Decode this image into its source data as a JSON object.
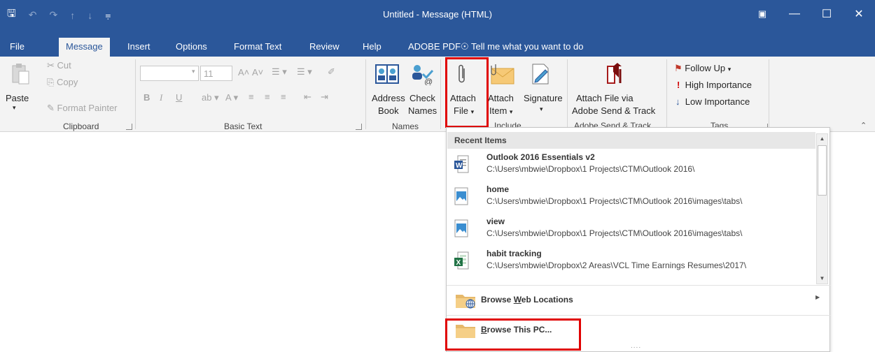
{
  "window": {
    "title": "Untitled  -  Message (HTML)",
    "qat": [
      "save-icon",
      "undo-icon",
      "redo-icon",
      "up-icon",
      "down-icon",
      "customize-icon"
    ]
  },
  "tabs": [
    "File",
    "Message",
    "Insert",
    "Options",
    "Format Text",
    "Review",
    "Help",
    "ADOBE PDF"
  ],
  "tell_me": "Tell me what you want to do",
  "ribbon": {
    "clipboard": {
      "paste": "Paste",
      "cut": "Cut",
      "copy": "Copy",
      "format_painter": "Format Painter",
      "label": "Clipboard"
    },
    "basic_text": {
      "font_size": "11",
      "bold": "B",
      "italic": "I",
      "underline": "U",
      "label": "Basic Text"
    },
    "names": {
      "address_book_1": "Address",
      "address_book_2": "Book",
      "check_names_1": "Check",
      "check_names_2": "Names",
      "label": "Names"
    },
    "include": {
      "attach_file_1": "Attach",
      "attach_file_2": "File",
      "attach_item_1": "Attach",
      "attach_item_2": "Item",
      "signature": "Signature",
      "label": "Include"
    },
    "adobe": {
      "line1": "Attach File via",
      "line2": "Adobe Send & Track",
      "label": "Adobe Send & Track"
    },
    "tags": {
      "follow_up": "Follow Up",
      "high": "High Importance",
      "low": "Low Importance",
      "label": "Tags"
    }
  },
  "menu": {
    "header": "Recent Items",
    "items": [
      {
        "name": "Outlook 2016 Essentials v2",
        "path": "C:\\Users\\mbwie\\Dropbox\\1 Projects\\CTM\\Outlook 2016\\",
        "icon": "word-doc-icon"
      },
      {
        "name": "home",
        "path": "C:\\Users\\mbwie\\Dropbox\\1 Projects\\CTM\\Outlook 2016\\images\\tabs\\",
        "icon": "image-file-icon"
      },
      {
        "name": "view",
        "path": "C:\\Users\\mbwie\\Dropbox\\1 Projects\\CTM\\Outlook 2016\\images\\tabs\\",
        "icon": "image-file-icon"
      },
      {
        "name": "habit tracking",
        "path": "C:\\Users\\mbwie\\Dropbox\\2 Areas\\VCL Time Earnings Resumes\\2017\\",
        "icon": "excel-file-icon"
      }
    ],
    "browse_web": "Browse Web Locations",
    "browse_pc": "Browse This PC...",
    "more": "....",
    "colors": {
      "highlight": "#e00000",
      "brand": "#2b579a"
    }
  }
}
